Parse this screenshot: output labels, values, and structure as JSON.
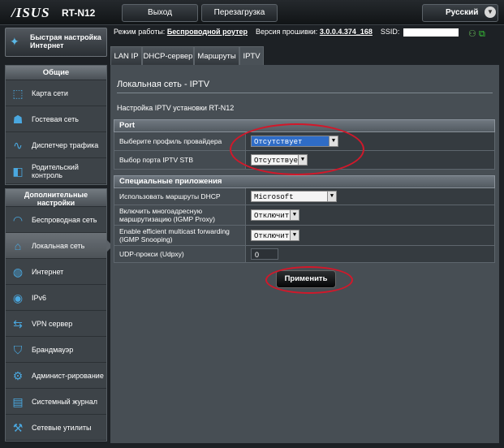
{
  "header": {
    "logo": "/ISUS",
    "model": "RT-N12",
    "logout": "Выход",
    "reboot": "Перезагрузка",
    "language": "Русский"
  },
  "info": {
    "mode_label": "Режим работы:",
    "mode_value": "Беспроводной роутер",
    "fw_label": "Версия прошивки:",
    "fw_value": "3.0.0.4.374_168",
    "ssid_label": "SSID:"
  },
  "sidebar": {
    "quick_setup": "Быстрая настройка Интернет",
    "general_title": "Общие",
    "general_items": [
      {
        "label": "Карта сети",
        "icon": "network-map-icon",
        "glyph": "⬚"
      },
      {
        "label": "Гостевая сеть",
        "icon": "guest-network-icon",
        "glyph": "☗"
      },
      {
        "label": "Диспетчер трафика",
        "icon": "traffic-manager-icon",
        "glyph": "∿"
      },
      {
        "label": "Родительский контроль",
        "icon": "parental-control-icon",
        "glyph": "◧"
      }
    ],
    "advanced_title": "Дополнительные настройки",
    "advanced_items": [
      {
        "label": "Беспроводная сеть",
        "icon": "wireless-icon",
        "glyph": "◠"
      },
      {
        "label": "Локальная сеть",
        "icon": "lan-icon",
        "glyph": "⌂"
      },
      {
        "label": "Интернет",
        "icon": "internet-globe-icon",
        "glyph": "◍"
      },
      {
        "label": "IPv6",
        "icon": "ipv6-icon",
        "glyph": "◉"
      },
      {
        "label": "VPN сервер",
        "icon": "vpn-icon",
        "glyph": "⇆"
      },
      {
        "label": "Брандмауэр",
        "icon": "firewall-shield-icon",
        "glyph": "⛉"
      },
      {
        "label": "Админист-рирование",
        "icon": "admin-icon",
        "glyph": "⚙"
      },
      {
        "label": "Системный журнал",
        "icon": "system-log-icon",
        "glyph": "▤"
      },
      {
        "label": "Сетевые утилиты",
        "icon": "network-tools-icon",
        "glyph": "⚒"
      }
    ]
  },
  "tabs": [
    "LAN IP",
    "DHCP-сервер",
    "Маршруты",
    "IPTV"
  ],
  "panel": {
    "title": "Локальная сеть - IPTV",
    "description": "Настройка IPTV установки RT-N12",
    "port_section": "Port",
    "port_rows": [
      {
        "label": "Выберите профиль провайдера",
        "value": "Отсутствует"
      },
      {
        "label": "Выбор порта IPTV STB",
        "value": "Отсутствует"
      }
    ],
    "special_section": "Специальные приложения",
    "special_rows": [
      {
        "label": "Использовать маршруты DHCP",
        "value": "Microsoft"
      },
      {
        "label": "Включить многоадресную маршрутизацию (IGMP Proxy)",
        "value": "Отключить"
      },
      {
        "label": "Enable efficient multicast forwarding (IGMP Snooping)",
        "value": "Отключить"
      },
      {
        "label": "UDP-прокси (Udpxy)",
        "value": "0"
      }
    ],
    "apply": "Применить"
  },
  "colors": {
    "accent": "#4aa8e0",
    "highlight_ring": "#d2182a",
    "select_highlight": "#2f6cc6"
  }
}
